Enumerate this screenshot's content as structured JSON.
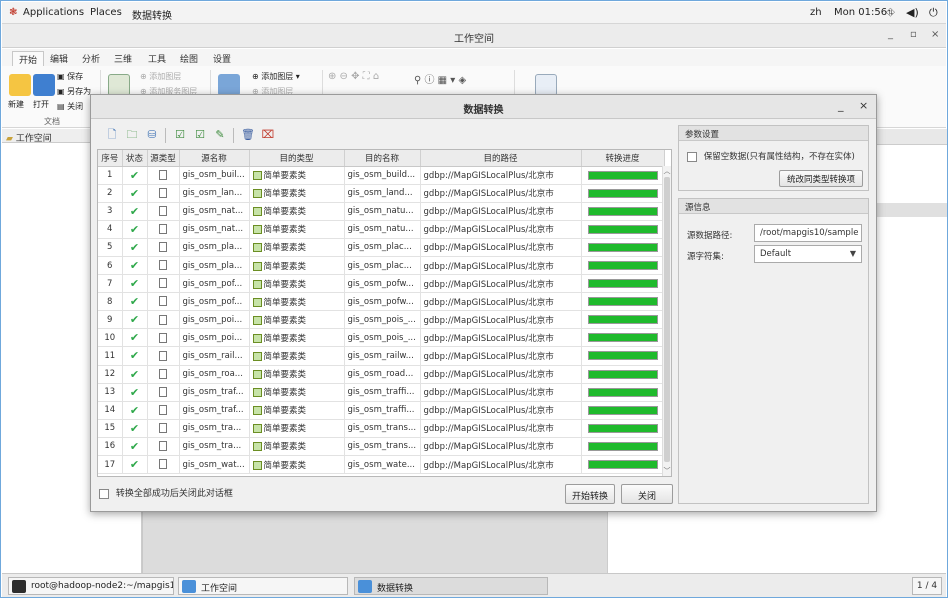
{
  "topbar": {
    "applications": "Applications",
    "places": "Places",
    "active_app": "数据转换",
    "lang": "zh",
    "clock": "Mon 01:56"
  },
  "window": {
    "title": "工作空间",
    "minimize": "_",
    "maximize": "▫",
    "close": "×"
  },
  "ribbon": {
    "tabs": [
      "开始",
      "编辑",
      "分析",
      "三维",
      "工具",
      "绘图",
      "设置"
    ],
    "new_label": "新建",
    "open_label": "打开",
    "save_label": "保存",
    "save_as_label": "另存为",
    "close_label": "关闭",
    "group_doc": "文档",
    "add_layer": "添加图层",
    "add_layer2": "添加图层",
    "add_layer_disabled": "添加图层",
    "add_template_disabled": "添加服务图层"
  },
  "left_panel": {
    "title": "工作空间"
  },
  "dialog": {
    "title": "数据转换",
    "minimize": "_",
    "close": "×",
    "columns": [
      "序号",
      "状态",
      "源类型",
      "源名称",
      "目的类型",
      "目的名称",
      "目的路径",
      "转换进度"
    ],
    "rows": [
      {
        "no": "1",
        "src": "gis_osm_buil...",
        "dtype": "简单要素类",
        "dname": "gis_osm_build...",
        "path": "gdbp://MapGISLocalPlus/北京市",
        "progress": 1.0
      },
      {
        "no": "2",
        "src": "gis_osm_lan...",
        "dtype": "简单要素类",
        "dname": "gis_osm_land...",
        "path": "gdbp://MapGISLocalPlus/北京市",
        "progress": 1.0
      },
      {
        "no": "3",
        "src": "gis_osm_nat...",
        "dtype": "简单要素类",
        "dname": "gis_osm_natu...",
        "path": "gdbp://MapGISLocalPlus/北京市",
        "progress": 1.0
      },
      {
        "no": "4",
        "src": "gis_osm_nat...",
        "dtype": "简单要素类",
        "dname": "gis_osm_natu...",
        "path": "gdbp://MapGISLocalPlus/北京市",
        "progress": 1.0
      },
      {
        "no": "5",
        "src": "gis_osm_pla...",
        "dtype": "简单要素类",
        "dname": "gis_osm_plac...",
        "path": "gdbp://MapGISLocalPlus/北京市",
        "progress": 1.0
      },
      {
        "no": "6",
        "src": "gis_osm_pla...",
        "dtype": "简单要素类",
        "dname": "gis_osm_plac...",
        "path": "gdbp://MapGISLocalPlus/北京市",
        "progress": 1.0
      },
      {
        "no": "7",
        "src": "gis_osm_pof...",
        "dtype": "简单要素类",
        "dname": "gis_osm_pofw...",
        "path": "gdbp://MapGISLocalPlus/北京市",
        "progress": 1.0
      },
      {
        "no": "8",
        "src": "gis_osm_pof...",
        "dtype": "简单要素类",
        "dname": "gis_osm_pofw...",
        "path": "gdbp://MapGISLocalPlus/北京市",
        "progress": 1.0
      },
      {
        "no": "9",
        "src": "gis_osm_poi...",
        "dtype": "简单要素类",
        "dname": "gis_osm_pois_...",
        "path": "gdbp://MapGISLocalPlus/北京市",
        "progress": 1.0
      },
      {
        "no": "10",
        "src": "gis_osm_poi...",
        "dtype": "简单要素类",
        "dname": "gis_osm_pois_...",
        "path": "gdbp://MapGISLocalPlus/北京市",
        "progress": 1.0
      },
      {
        "no": "11",
        "src": "gis_osm_rail...",
        "dtype": "简单要素类",
        "dname": "gis_osm_railw...",
        "path": "gdbp://MapGISLocalPlus/北京市",
        "progress": 1.0
      },
      {
        "no": "12",
        "src": "gis_osm_roa...",
        "dtype": "简单要素类",
        "dname": "gis_osm_road...",
        "path": "gdbp://MapGISLocalPlus/北京市",
        "progress": 1.0
      },
      {
        "no": "13",
        "src": "gis_osm_traf...",
        "dtype": "简单要素类",
        "dname": "gis_osm_traffi...",
        "path": "gdbp://MapGISLocalPlus/北京市",
        "progress": 1.0
      },
      {
        "no": "14",
        "src": "gis_osm_traf...",
        "dtype": "简单要素类",
        "dname": "gis_osm_traffi...",
        "path": "gdbp://MapGISLocalPlus/北京市",
        "progress": 1.0
      },
      {
        "no": "15",
        "src": "gis_osm_tra...",
        "dtype": "简单要素类",
        "dname": "gis_osm_trans...",
        "path": "gdbp://MapGISLocalPlus/北京市",
        "progress": 1.0
      },
      {
        "no": "16",
        "src": "gis_osm_tra...",
        "dtype": "简单要素类",
        "dname": "gis_osm_trans...",
        "path": "gdbp://MapGISLocalPlus/北京市",
        "progress": 1.0
      },
      {
        "no": "17",
        "src": "gis_osm_wat...",
        "dtype": "简单要素类",
        "dname": "gis_osm_wate...",
        "path": "gdbp://MapGISLocalPlus/北京市",
        "progress": 1.0
      }
    ],
    "close_after_label": "转换全部成功后关闭此对话框",
    "start_button": "开始转换",
    "close_button": "关闭",
    "params": {
      "title": "参数设置",
      "keep_empty": "保留空数据(只有属性结构，不存在实体)",
      "unify_button": "统改同类型转换项"
    },
    "source_info": {
      "title": "源信息",
      "path_label": "源数据路径:",
      "path_value": "/root/mapgis10/sample",
      "charset_label": "源字符集:",
      "charset_value": "Default"
    }
  },
  "taskbar": {
    "terminal": "root@hadoop-node2:~/mapgis10/p...",
    "workspace": "工作空间",
    "convert": "数据转换",
    "pager": "1 / 4"
  },
  "colors": {
    "progress_fill": "#1fba2c",
    "check": "#2ea84a",
    "dialog_bg": "#f0f0f0"
  }
}
